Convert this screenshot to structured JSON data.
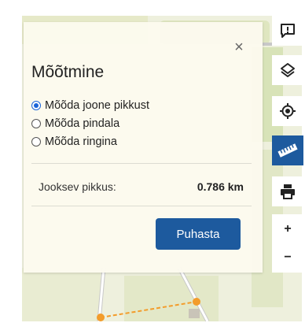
{
  "panel": {
    "title": "Mõõtmine",
    "close_symbol": "×",
    "options": [
      {
        "label": "Mõõda joone pikkust",
        "selected": true
      },
      {
        "label": "Mõõda pindala",
        "selected": false
      },
      {
        "label": "Mõõda ringina",
        "selected": false
      }
    ],
    "length_label": "Jooksev pikkus:",
    "length_value": "0.786 km",
    "clear_button": "Puhasta"
  },
  "toolbar": {
    "items": [
      {
        "icon": "feedback-icon"
      },
      {
        "icon": "layers-icon"
      },
      {
        "icon": "locate-icon"
      },
      {
        "icon": "ruler-icon",
        "active": true
      },
      {
        "icon": "print-icon"
      }
    ],
    "zoom_in": "+",
    "zoom_out": "−"
  },
  "colors": {
    "accent": "#1d5a9e",
    "radio_selected": "#1a64d8",
    "measure_line": "#f39c2b"
  }
}
